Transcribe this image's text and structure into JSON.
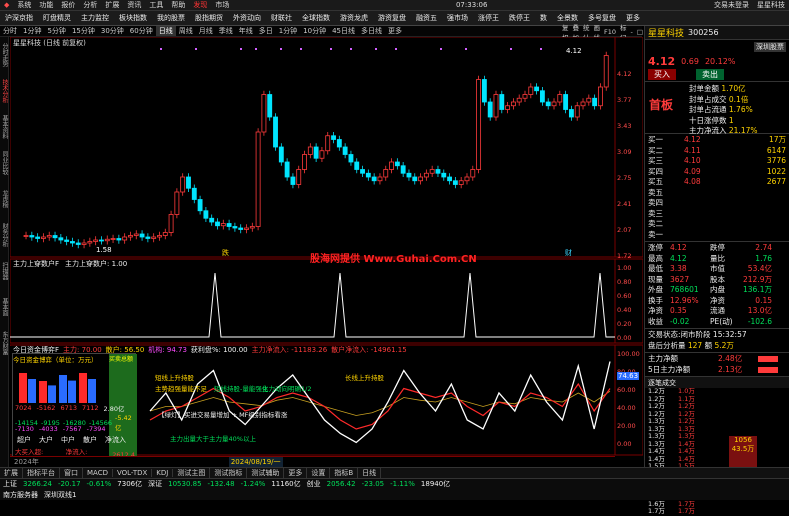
{
  "menubar": {
    "items": [
      "系统",
      "功能",
      "报价",
      "分析",
      "扩展",
      "资讯",
      "工具",
      "帮助"
    ],
    "active": "发现",
    "active2": "市场",
    "title": "交易未登录",
    "stock_title": "星星科技",
    "time": "07:33:06"
  },
  "toolbar": {
    "items": [
      "沪深京指",
      "盯盘精灵",
      "主力监控",
      "板块指数",
      "我的股票",
      "股指期货",
      "外资动向",
      "财联社",
      "全球指数",
      "游资龙虎",
      "游资复盘",
      "融资五",
      "强市场",
      "涨停王",
      "跌停王",
      "数",
      "全景数",
      "多号复盘",
      "更多"
    ]
  },
  "periodbar": {
    "items": [
      "分时",
      "1分钟",
      "5分钟",
      "15分钟",
      "30分钟",
      "60分钟",
      "日线",
      "周线",
      "月线",
      "季线",
      "年线",
      "多日",
      "1分钟",
      "10分钟",
      "45日线",
      "多日线",
      "更多"
    ],
    "right": [
      "复权",
      "叠加",
      "统计",
      "画线",
      "F10",
      "标记",
      "-",
      "□",
      "×"
    ]
  },
  "leftrail": [
    "分时走势",
    "技术分析",
    "基本资料",
    "同业比较",
    "龙虎榜",
    "财务分析",
    "扫描器",
    "基本面",
    "东方财富"
  ],
  "kline": {
    "title": "星星科技 (日线 前复权)",
    "y_labels": [
      "4.12",
      "3.77",
      "3.43",
      "3.09",
      "2.75",
      "2.41",
      "2.07",
      "1.72"
    ],
    "low_label": "1.58",
    "high_label": "4.12",
    "markers": [
      "跌",
      "跌",
      "跌",
      "财"
    ]
  },
  "watermark": "股海网提供 Www.Guhai.Com.CN",
  "ind1": {
    "title": "主力上穿数户F",
    "subtitle": "主力上穿数户: 1.00",
    "y_labels": [
      "1.00",
      "0.80",
      "0.60",
      "0.40",
      "0.20",
      "0.00"
    ]
  },
  "ind2": {
    "title": "今日资金博弈F",
    "items": [
      {
        "t": "主力: 70.00",
        "c": "red"
      },
      {
        "t": "散户: 56.50",
        "c": "yel"
      },
      {
        "t": "机构: 94.73",
        "c": "mag"
      },
      {
        "t": "获利盘%: 100.00",
        "c": "wht"
      },
      {
        "t": "主力净流入: -11183.26",
        "c": "red"
      },
      {
        "t": "散户净流入: -14961.15",
        "c": "red"
      }
    ],
    "y_labels": [
      "100.00",
      "80.00",
      "60.00",
      "40.00",
      "20.00",
      "0.00"
    ],
    "tag": "74.63",
    "ann": [
      {
        "t": "短线上升持股",
        "c": "yel"
      },
      {
        "t": "主势趋强量能不足",
        "c": "yel"
      },
      {
        "t": "短线持股-量能强化",
        "c": "grn"
      },
      {
        "t": "主力动向明确1/2",
        "c": "grn"
      },
      {
        "t": "长线上升持股",
        "c": "yel"
      },
      {
        "t": "【绿灯】买进交易量增加 + MF级别指标看涨",
        "c": "wht"
      },
      {
        "t": "主力出量大于主力量40%以上",
        "c": "grn"
      }
    ]
  },
  "capbox": {
    "title": "今日资金博弈（单位：万元）",
    "title2": "买卖总额",
    "row1": [
      "7024",
      "-5162",
      "6713",
      "7112",
      "2.80亿"
    ],
    "row2": [
      "-14154",
      "-9195",
      "-16280",
      "-14566",
      "-5.42亿"
    ],
    "row3": [
      "-7130",
      "-4033",
      "-7567",
      "-7394"
    ],
    "labels": [
      "超户",
      "大户",
      "中户",
      "散户",
      "净流入"
    ],
    "foot": "大买入超: -15.90",
    "foot2": "净流入: -14961",
    "foot3": "2612.4"
  },
  "timeaxis": {
    "left": "2024年",
    "right": "2024/08/19/一"
  },
  "stock": {
    "name": "星星科技",
    "code": "300256",
    "tag": "深圳股票",
    "price": "4.12",
    "change": "0.69",
    "pct": "20.12%",
    "buy": "买入",
    "sell": "卖出",
    "title": "首板",
    "seal_amount": "封单金额",
    "seal_amount_v": "1.70亿",
    "seal_vol": "封单占成交",
    "seal_vol_v": "0.1倍",
    "seal_flow": "封单占流通",
    "seal_flow_v": "1.76%",
    "ten_day": "十日涨停数",
    "ten_day_v": "1",
    "main_net": "主力净流入",
    "main_net_v": "21.17%"
  },
  "orderbook": {
    "sell": [
      {
        "l": "卖五",
        "p": "",
        "v": ""
      },
      {
        "l": "卖四",
        "p": "",
        "v": ""
      },
      {
        "l": "卖三",
        "p": "",
        "v": ""
      },
      {
        "l": "卖二",
        "p": "",
        "v": ""
      },
      {
        "l": "卖一",
        "p": "",
        "v": ""
      }
    ],
    "buy": [
      {
        "l": "买一",
        "p": "4.12",
        "v": "17万"
      },
      {
        "l": "买二",
        "p": "4.11",
        "v": "6147"
      },
      {
        "l": "买三",
        "p": "4.10",
        "v": "3776"
      },
      {
        "l": "买四",
        "p": "4.09",
        "v": "1022"
      },
      {
        "l": "买五",
        "p": "4.08",
        "v": "2677"
      }
    ]
  },
  "stats": [
    [
      "涨停",
      "4.12",
      "跌停",
      "2.74"
    ],
    [
      "最高",
      "4.12",
      "量比",
      "1.76"
    ],
    [
      "最低",
      "3.38",
      "市值",
      "53.4亿"
    ],
    [
      "现量",
      "3627",
      "股本",
      "212.9万"
    ],
    [
      "外盘",
      "768601",
      "内盘",
      "136.1万"
    ],
    [
      "换手",
      "12.96%",
      "净资",
      "0.15"
    ],
    [
      "净资",
      "0.35",
      "流通",
      "13.0亿"
    ],
    [
      "收益",
      "-0.02",
      "PE(动)",
      "-102.6"
    ]
  ],
  "tradestate": {
    "label": "交易状态:",
    "value": "闭市阶段",
    "time": "15:32:57",
    "line2": "盘后分析量",
    "line2v": "127",
    "line2b": "额",
    "line2c": "5.2万"
  },
  "mainflow": [
    {
      "l": "主力净额",
      "v": "2.48亿",
      "c": "red"
    },
    {
      "l": "5日主力净额",
      "v": "2.13亿",
      "c": "red"
    }
  ],
  "ticklist": {
    "title": "逐笔成交",
    "items": [
      [
        "1.2万",
        "1.0万"
      ],
      [
        "1.2万",
        "1.1万"
      ],
      [
        "1.2万",
        "1.2万"
      ],
      [
        "1.2万",
        "1.2万"
      ],
      [
        "1.3万",
        "1.2万"
      ],
      [
        "1.3万",
        "1.3万"
      ],
      [
        "1.3万",
        "1.3万"
      ],
      [
        "1.3万",
        "1.4万"
      ],
      [
        "1.4万",
        "1.4万"
      ],
      [
        "1.4万",
        "1.4万"
      ],
      [
        "1.5万",
        "1.5万"
      ],
      [
        "1.5万",
        "1.5万"
      ],
      [
        "1.5万",
        "1.6万"
      ],
      [
        "1.6万",
        "1.6万"
      ],
      [
        "1.6万",
        "1.6万"
      ],
      [
        "1.6万",
        "1.7万"
      ],
      [
        "1.7万",
        "1.7万"
      ]
    ],
    "big": "1056",
    "big2": "43.5万"
  },
  "bottabs": [
    "扩展",
    "指标平台",
    "窗口",
    "MACD",
    "VOL-TDX",
    "KDJ",
    "测试主图",
    "测试指标",
    "测试辅助",
    "更多",
    "设置",
    "指标B",
    "日线"
  ],
  "status": {
    "sh_label": "上证",
    "sh": "3266.24",
    "sh_chg": "-20.17",
    "sh_pct": "-0.61%",
    "sh_amt": "7306亿",
    "sz_label": "深证",
    "sz": "10530.85",
    "sz_chg": "-132.48",
    "sz_pct": "-1.24%",
    "sz_amt": "11160亿",
    "cy_label": "创业",
    "cy": "2056.42",
    "cy_chg": "-23.05",
    "cy_pct": "-1.11%",
    "cy_amt": "18940亿",
    "server": "南方服务器",
    "server2": "深圳双线1"
  },
  "colors": {
    "up": "#ff3b3b",
    "down": "#00e5ff",
    "bg": "#000000",
    "grid": "#7a0000"
  }
}
